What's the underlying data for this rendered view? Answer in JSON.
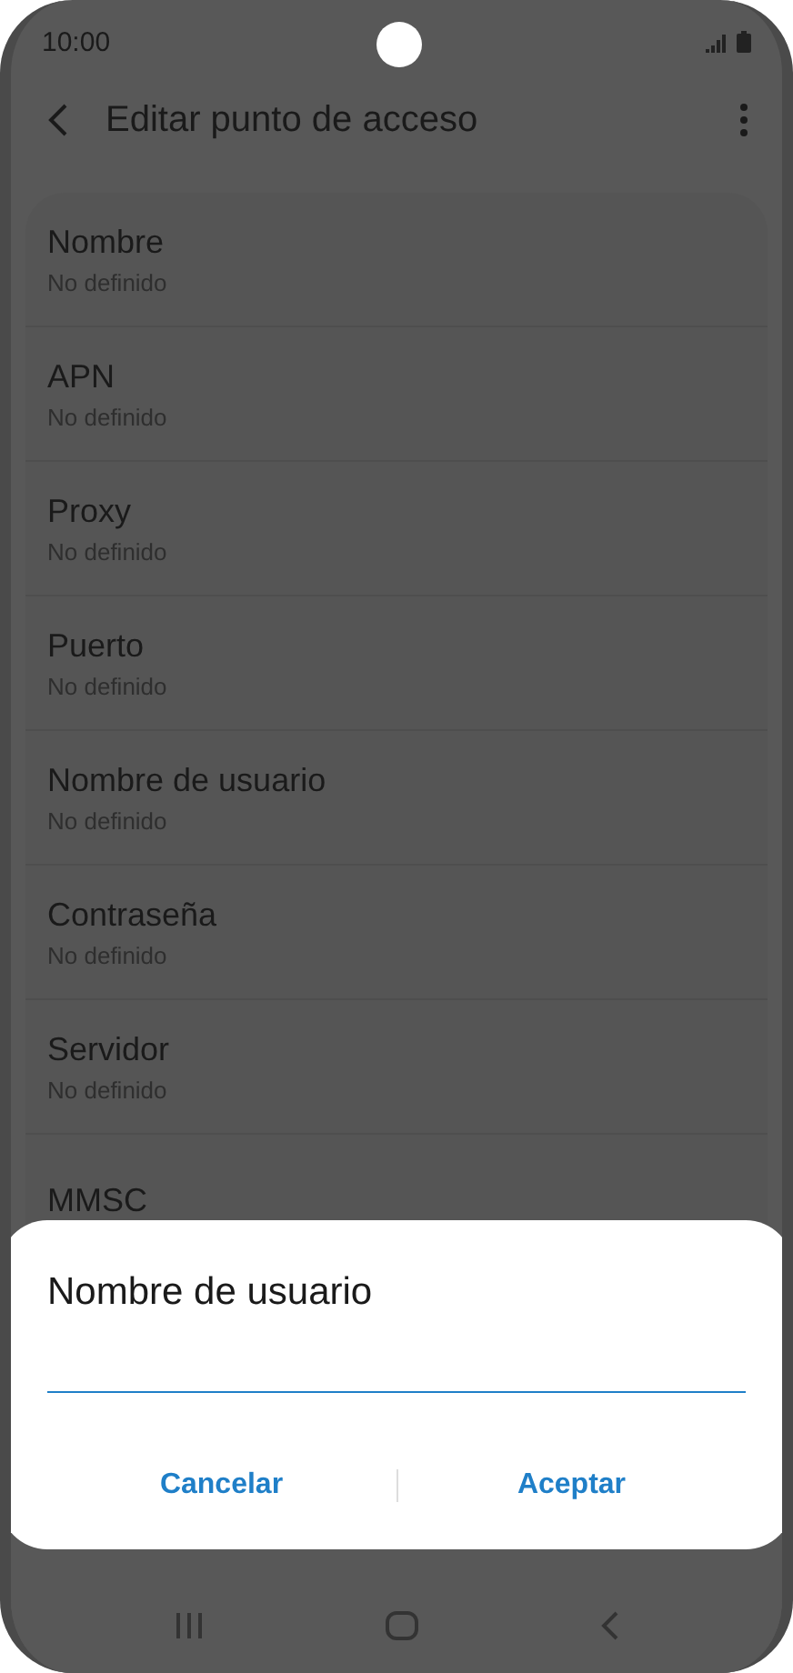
{
  "status_bar": {
    "time": "10:00"
  },
  "app_bar": {
    "title": "Editar punto de acceso"
  },
  "fields": [
    {
      "label": "Nombre",
      "value": "No definido"
    },
    {
      "label": "APN",
      "value": "No definido"
    },
    {
      "label": "Proxy",
      "value": "No definido"
    },
    {
      "label": "Puerto",
      "value": "No definido"
    },
    {
      "label": "Nombre de usuario",
      "value": "No definido"
    },
    {
      "label": "Contraseña",
      "value": "No definido"
    },
    {
      "label": "Servidor",
      "value": "No definido"
    },
    {
      "label": "MMSC"
    }
  ],
  "dialog": {
    "title": "Nombre de usuario",
    "buttons": [
      "Cancelar",
      "Aceptar"
    ]
  }
}
